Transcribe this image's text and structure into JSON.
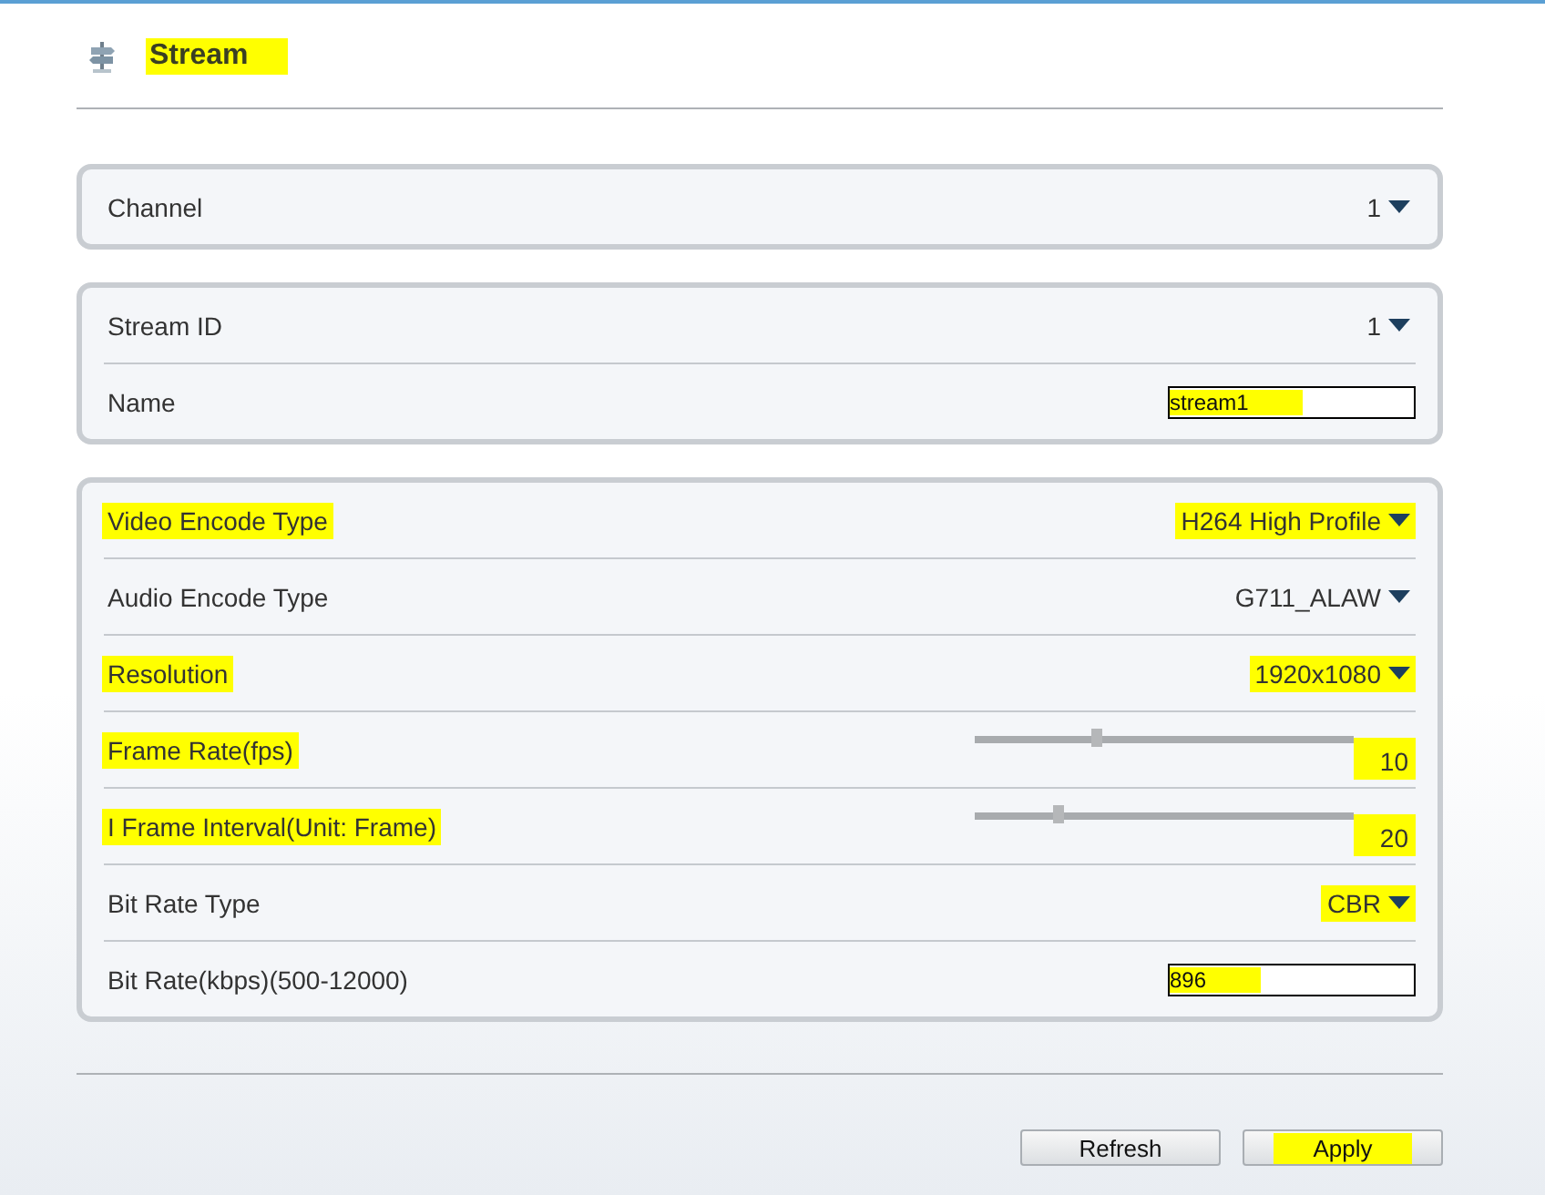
{
  "page": {
    "title": "Stream",
    "title_highlighted": true
  },
  "panels": [
    {
      "rows": [
        {
          "kind": "select",
          "label": "Channel",
          "label_highlighted": false,
          "value": "1",
          "value_highlighted": false
        }
      ]
    },
    {
      "rows": [
        {
          "kind": "select",
          "label": "Stream ID",
          "label_highlighted": false,
          "value": "1",
          "value_highlighted": false
        },
        {
          "kind": "input",
          "label": "Name",
          "label_highlighted": false,
          "value": "stream1",
          "value_highlighted": true
        }
      ]
    },
    {
      "rows": [
        {
          "kind": "select",
          "label": "Video Encode Type",
          "label_highlighted": true,
          "value": "H264 High Profile",
          "value_highlighted": true
        },
        {
          "kind": "select",
          "label": "Audio Encode Type",
          "label_highlighted": false,
          "value": "G711_ALAW",
          "value_highlighted": false
        },
        {
          "kind": "select",
          "label": "Resolution",
          "label_highlighted": true,
          "value": "1920x1080",
          "value_highlighted": true
        },
        {
          "kind": "slider",
          "label": "Frame Rate(fps)",
          "label_highlighted": true,
          "level": 0.32,
          "value": "10",
          "value_highlighted": true
        },
        {
          "kind": "slider",
          "label": "I Frame Interval(Unit: Frame)",
          "label_highlighted": true,
          "level": 0.22,
          "value": "20",
          "value_highlighted": true
        },
        {
          "kind": "select",
          "label": "Bit Rate Type",
          "label_highlighted": false,
          "value": "CBR",
          "value_highlighted": true
        },
        {
          "kind": "input",
          "label": "Bit Rate(kbps)(500-12000)",
          "label_highlighted": false,
          "value": "896",
          "value_highlighted": true
        }
      ]
    }
  ],
  "buttons": [
    {
      "label": "Refresh",
      "highlighted": false
    },
    {
      "label": "Apply",
      "highlighted": true
    }
  ]
}
